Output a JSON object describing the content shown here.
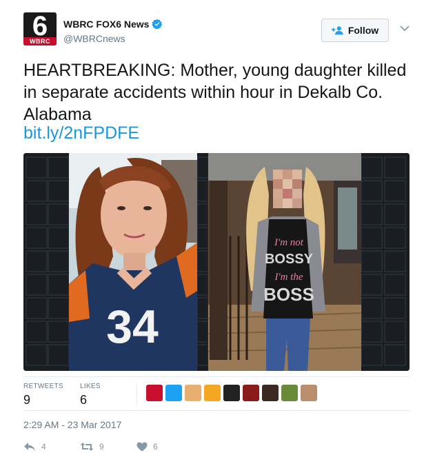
{
  "account": {
    "display_name": "WBRC FOX6 News",
    "handle": "@WBRCnews",
    "avatar_number": "6",
    "avatar_band": "WBRC",
    "verified_icon": "verified-badge-icon"
  },
  "follow": {
    "label": "Follow",
    "icon": "add-user-icon"
  },
  "tweet": {
    "text": "HEARTBREAKING: Mother, young daughter killed in separate accidents within hour in Dekalb Co. Alabama",
    "link": "bit.ly/2nFPDFE"
  },
  "photo": {
    "shirt_line1": "I'm not",
    "shirt_line2": "BOSSY",
    "shirt_line3": "I'm the",
    "shirt_line4": "BOSS",
    "jersey_number": "34"
  },
  "stats": {
    "retweets_label": "RETWEETS",
    "retweets_value": "9",
    "likes_label": "LIKES",
    "likes_value": "6"
  },
  "likers": [
    "#c8102e",
    "#1da1f2",
    "#e8b070",
    "#f5a623",
    "#222222",
    "#8b1a1a",
    "#3a2a22",
    "#6a8a3a",
    "#b89070"
  ],
  "timestamp": "2:29 AM - 23 Mar 2017",
  "actions": {
    "reply_count": "4",
    "retweet_count": "9",
    "like_count": "6"
  },
  "colors": {
    "accent": "#1b95e0",
    "muted": "#657786",
    "border": "#e6ecf0"
  }
}
